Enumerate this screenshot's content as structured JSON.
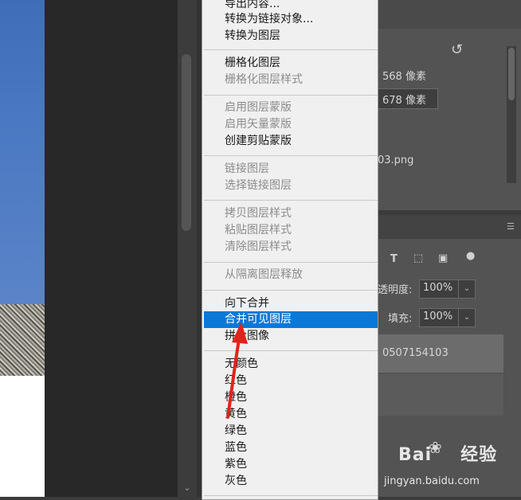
{
  "menu": {
    "items_top": [
      {
        "label": "导出内容...",
        "enabled": true
      },
      {
        "label": "转换为链接对象...",
        "enabled": true
      },
      {
        "label": "转换为图层",
        "enabled": true
      }
    ],
    "group_rasterize": [
      {
        "label": "栅格化图层",
        "enabled": true
      },
      {
        "label": "栅格化图层样式",
        "enabled": false
      }
    ],
    "group_mask": [
      {
        "label": "启用图层蒙版",
        "enabled": false
      },
      {
        "label": "启用矢量蒙版",
        "enabled": false
      },
      {
        "label": "创建剪贴蒙版",
        "enabled": true
      }
    ],
    "group_link": [
      {
        "label": "链接图层",
        "enabled": false
      },
      {
        "label": "选择链接图层",
        "enabled": false
      }
    ],
    "group_style": [
      {
        "label": "拷贝图层样式",
        "enabled": false
      },
      {
        "label": "粘贴图层样式",
        "enabled": false
      },
      {
        "label": "清除图层样式",
        "enabled": false
      }
    ],
    "group_isolate": [
      {
        "label": "从隔离图层释放",
        "enabled": false
      }
    ],
    "group_merge": [
      {
        "label": "向下合并",
        "enabled": true
      },
      {
        "label": "合并可见图层",
        "enabled": true,
        "highlighted": true
      },
      {
        "label": "拼合图像",
        "enabled": true
      }
    ],
    "group_colors": [
      {
        "label": "无颜色",
        "enabled": true
      },
      {
        "label": "红色",
        "enabled": true
      },
      {
        "label": "橙色",
        "enabled": true
      },
      {
        "label": "黄色",
        "enabled": true
      },
      {
        "label": "绿色",
        "enabled": true
      },
      {
        "label": "蓝色",
        "enabled": true
      },
      {
        "label": "紫色",
        "enabled": true
      },
      {
        "label": "灰色",
        "enabled": true
      }
    ]
  },
  "properties": {
    "width_value": "568 像素",
    "height_value": "678 像素",
    "filename": "03.png",
    "undo_icon": "undo-icon"
  },
  "layers": {
    "opacity_label": "透明度:",
    "opacity_value": "100%",
    "fill_label": "填充:",
    "fill_value": "100%",
    "layer_name": "0507154103",
    "filter_icons": [
      "text-icon",
      "transform-icon",
      "smart-object-icon",
      "toggle-icon"
    ]
  },
  "watermark": {
    "brand": "Bai",
    "brand_suffix": "经验",
    "url": "jingyan.baidu.com"
  },
  "colors": {
    "highlight": "#0a78d7",
    "arrow": "#e0241b"
  }
}
